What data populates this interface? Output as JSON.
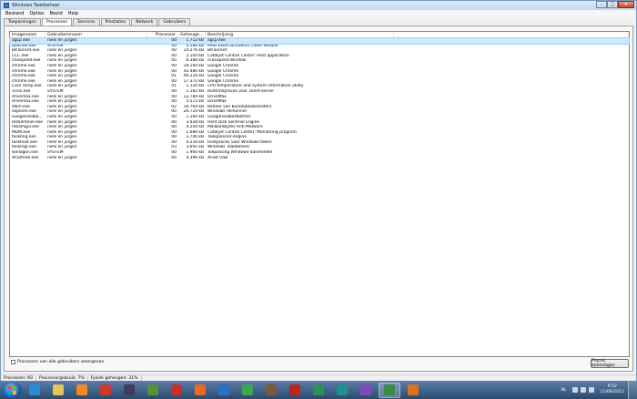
{
  "window": {
    "title": "Windows Taakbeheer",
    "controls": {
      "minimize": "–",
      "maximize": "□",
      "close": "✕"
    }
  },
  "menu": [
    "Bestand",
    "Opties",
    "Beeld",
    "Help"
  ],
  "tabs": [
    "Toepassingen",
    "Processen",
    "Services",
    "Prestaties",
    "Netwerk",
    "Gebruikers"
  ],
  "active_tab": "Processen",
  "columns": [
    "Imagenaam",
    "Gebruikersnaam",
    "Processor",
    "Geheuge...",
    "Beschrijving"
  ],
  "rows": [
    [
      "agcp.exe",
      "niels en jurgen",
      "00",
      "1.712 kB",
      "agcp.exe"
    ],
    [
      "atieclxx.exe",
      "SYSTEM",
      "00",
      "3.180 kB",
      "AMD External Events Client Module"
    ],
    [
      "BitTorrent.exe",
      "niels en jurgen",
      "00",
      "14.276 kB",
      "BitTorrent"
    ],
    [
      "CCC.exe",
      "niels en jurgen",
      "00",
      "2.104 kB",
      "Catalyst Control Center: Host application"
    ],
    [
      "cfosspeed.exe",
      "niels en jurgen",
      "00",
      "8.388 kB",
      "cFosSpeed Window"
    ],
    [
      "chrome.exe",
      "niels en jurgen",
      "00",
      "18.100 kB",
      "Google Chrome"
    ],
    [
      "chrome.exe",
      "niels en jurgen",
      "00",
      "42.480 kB",
      "Google Chrome"
    ],
    [
      "chrome.exe",
      "niels en jurgen",
      "01",
      "46.216 kB",
      "Google Chrome"
    ],
    [
      "chrome.exe",
      "niels en jurgen",
      "00",
      "17.372 kB",
      "Google Chrome"
    ],
    [
      "Core Temp.exe",
      "niels en jurgen",
      "01",
      "1.120 kB",
      "CPU temperature and system information utility"
    ],
    [
      "csrss.exe",
      "SYSTEM",
      "00",
      "1.192 kB",
      "Runtimeproces voor client-server"
    ],
    [
      "drivemax.exe",
      "niels en jurgen",
      "00",
      "12.784 kB",
      "DriveMax"
    ],
    [
      "drivemax.exe",
      "niels en jurgen",
      "00",
      "5.572 kB",
      "DriveMax"
    ],
    [
      "dwm.exe",
      "niels en jurgen",
      "02",
      "16.764 kB",
      "Beheer van bureaubladvensters"
    ],
    [
      "explorer.exe",
      "niels en jurgen",
      "00",
      "26.724 kB",
      "Windows Verkenner"
    ],
    [
      "GoogleToolba...",
      "niels en jurgen",
      "00",
      "1.160 kB",
      "GoogleToolbarNotifier"
    ],
    [
      "HDSentinel.exe",
      "niels en jurgen",
      "00",
      "3.028 kB",
      "Hard Disk Sentinel Engine"
    ],
    [
      "mbamgui.exe",
      "niels en jurgen",
      "00",
      "4.204 kB",
      "Malwarebytes Anti-Malware"
    ],
    [
      "MOM.exe",
      "niels en jurgen",
      "00",
      "1.680 kB",
      "Catalyst Control Center: Monitoring program"
    ],
    [
      "taskeng.exe",
      "niels en jurgen",
      "00",
      "3.740 kB",
      "Taakplanner-engine"
    ],
    [
      "taskhost.exe",
      "niels en jurgen",
      "00",
      "4.216 kB",
      "Hostproces voor Windows-taken"
    ],
    [
      "taskmgr.exe",
      "niels en jurgen",
      "03",
      "3.692 kB",
      "Windows Taakbeheer"
    ],
    [
      "winlogon.exe",
      "SYSTEM",
      "00",
      "1.900 kB",
      "Toepassing Windows-aanmelden"
    ],
    [
      "XFastUsb.exe",
      "niels en jurgen",
      "00",
      "4.396 kB",
      "XFast USB"
    ]
  ],
  "show_all_label": "Processen van alle gebruikers weergeven",
  "end_process_label": "Proces beëindigen",
  "status": {
    "processes": "Processen: 60",
    "cpu": "Processorgebruik: 7%",
    "memory": "Fysiek geheugen: 31%"
  },
  "taskbar": {
    "apps": [
      {
        "name": "ie-icon",
        "color": "#2a8ad8"
      },
      {
        "name": "explorer-icon",
        "color": "#e8c35a"
      },
      {
        "name": "media-player-icon",
        "color": "#f08a24"
      },
      {
        "name": "app-icon-red",
        "color": "#c83c2a"
      },
      {
        "name": "app-icon-dark",
        "color": "#3d3d5a"
      },
      {
        "name": "app-icon-grid",
        "color": "#5a8f3c"
      },
      {
        "name": "flag-icon",
        "color": "#c4312d"
      },
      {
        "name": "firefox-icon",
        "color": "#e86a1f"
      },
      {
        "name": "app-icon-blue",
        "color": "#2f6fc0"
      },
      {
        "name": "chrome-icon",
        "color": "#3da54f"
      },
      {
        "name": "app-icon-brown",
        "color": "#7a5a3a"
      },
      {
        "name": "app-icon-m",
        "color": "#b8261f"
      },
      {
        "name": "app-icon-green",
        "color": "#2e8f5a"
      },
      {
        "name": "app-icon-teal",
        "color": "#1f8f8f"
      },
      {
        "name": "app-icon-purple",
        "color": "#7b4bb8"
      },
      {
        "name": "taskmgr-icon",
        "color": "#3a8a4a"
      },
      {
        "name": "app-icon-orange",
        "color": "#d9731f"
      }
    ],
    "active_index": 15,
    "lang": "NL",
    "time": "9:52",
    "date": "11/06/2012"
  }
}
